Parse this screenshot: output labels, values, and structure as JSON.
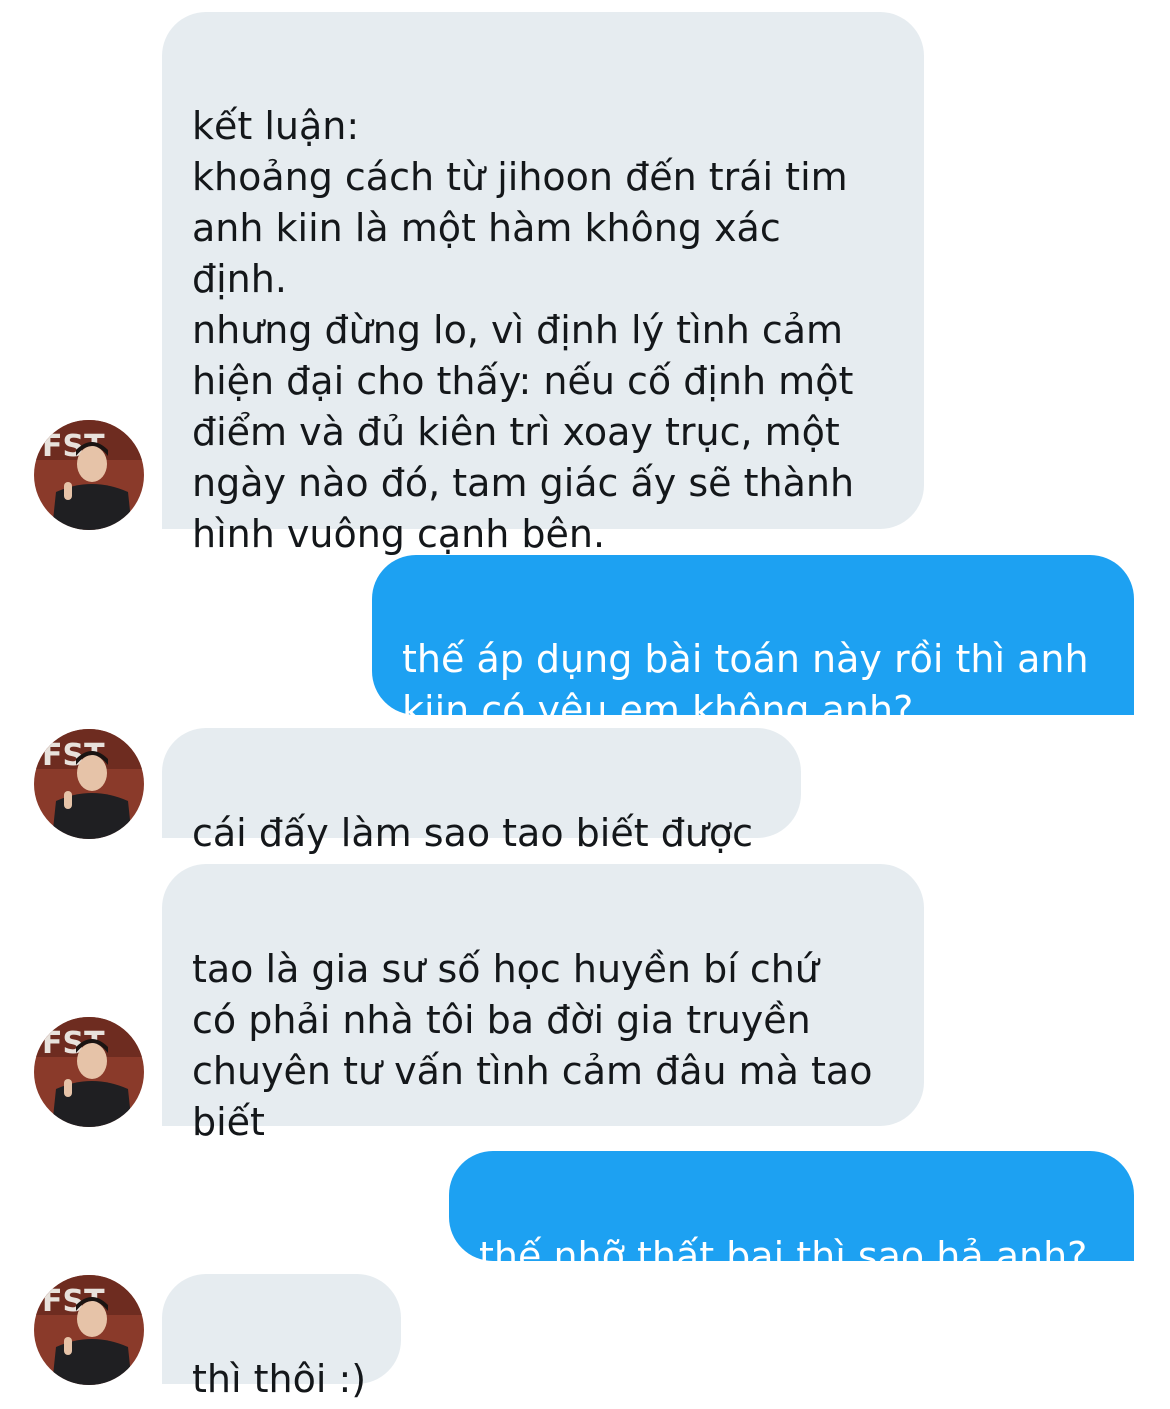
{
  "messages": [
    {
      "sender": "them",
      "text": "kết luận:\nkhoảng cách từ jihoon đến trái tim\nanh kiin là một hàm không xác\nđịnh.\nnhưng đừng lo, vì định lý tình cảm\nhiện đại cho thấy: nếu cố định một\nđiểm và đủ kiên trì xoay trục, một\nngày nào đó, tam giác ấy sẽ thành\nhình vuông cạnh bên."
    },
    {
      "sender": "me",
      "text": "thế áp dụng bài toán này rồi thì anh\nkiin có yêu em không anh?"
    },
    {
      "sender": "them",
      "text": "cái đấy làm sao tao biết được"
    },
    {
      "sender": "them",
      "text": "tao là gia sư số học huyền bí chứ\ncó phải nhà tôi ba đời gia truyền\nchuyên tư vấn tình cảm đâu mà tao\nbiết"
    },
    {
      "sender": "me",
      "text": "thế nhỡ thất bại thì sao hả anh?"
    },
    {
      "sender": "them",
      "text": "thì thôi :)"
    }
  ],
  "avatar": {
    "icon": "user-avatar-icon",
    "colors": {
      "background": "#8a3a2a",
      "jacket": "#1f1f22",
      "skin": "#e6c3a8",
      "hair": "#1a1412"
    }
  },
  "colors": {
    "incoming_bubble": "#e6ecf0",
    "outgoing_bubble": "#1da1f2",
    "incoming_text": "#14171a",
    "outgoing_text": "#ffffff"
  }
}
